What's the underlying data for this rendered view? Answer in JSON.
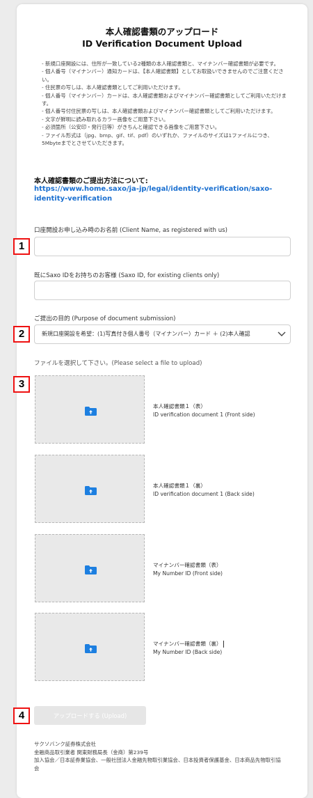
{
  "page": {
    "title": "本人確認書類のアップロード",
    "subtitle": "ID Verification Document Upload"
  },
  "notes": [
    "- 新規口座開設には、住所が一致している2種類の本人確認書類と、マイナンバー確認書類が必要です。",
    "- 個人番号（マイナンバー）通知カードは、【本人確認書類】としてお取扱いできませんのでご注意くださ",
    "い。",
    "- 住民票の写しは、本人確認書類としてご利用いただけます。",
    "- 個人番号（マイナンバー）カードは、本人確認書類およびマイナンバー確認書類としてご利用いただけま",
    "す。",
    "- 個人番号付住民票の写しは、本人確認書類およびマイナンバー確認書類としてご利用いただけます。",
    "- 文字が鮮明に読み取れるカラー画像をご用意下さい。",
    "- 必須箇所（公安印・発行日等）がきちんと確認できる画像をご用意下さい。",
    "- ファイル形式は（jpg、bmp、gif、tif、pdf）のいずれか、ファイルのサイズは1ファイルにつき、",
    "5Mbyteまでとさせていただきます。"
  ],
  "submission": {
    "heading": "本人確認書類のご提出方法について:",
    "link": "https://www.home.saxo/ja-jp/legal/identity-verification/saxo-identity-verification"
  },
  "form": {
    "client_name_label": "口座開設お申し込み時のお名前 (Client Name, as registered with us)",
    "client_name_value": "",
    "saxo_id_label": "既にSaxo IDをお持ちのお客様 (Saxo ID, for existing clients only)",
    "saxo_id_value": "",
    "purpose_label": "ご提出の目的 (Purpose of document submission)",
    "purpose_selected": "新規口座開設を希望：(1)写真付き個人番号（マイナンバー）カード ＋ (2)本人確認",
    "file_prompt": "ファイルを選択して下さい。(Please select a file to upload)"
  },
  "documents": [
    {
      "ja": "本人確認書類１（表）",
      "en": "ID verification document 1 (Front side)"
    },
    {
      "ja": "本人確認書類１（裏）",
      "en": "ID verification document 1 (Back side)"
    },
    {
      "ja": "マイナンバー確認書類（表）",
      "en": "My Number ID (Front side)"
    },
    {
      "ja": "マイナンバー確認書類（裏）",
      "en": "My Number ID (Back side)"
    }
  ],
  "upload_button": "アップロードする (Upload)",
  "badges": [
    "1",
    "2",
    "3",
    "4"
  ],
  "footer": [
    "サクソバンク証券株式会社",
    "金融商品取引業者 関東財務局長（金商）第239号",
    "加入協会／日本証券業協会、一般社団法人金融先物取引業協会、日本投資者保護基金、日本商品先物取引協",
    "会"
  ],
  "colors": {
    "accent_link": "#1a6fd0",
    "folder_icon": "#1d7fe0",
    "badge": "#ee1111"
  },
  "icons": {
    "upload": "folder-upload-icon",
    "select": "chevron-down-icon"
  }
}
